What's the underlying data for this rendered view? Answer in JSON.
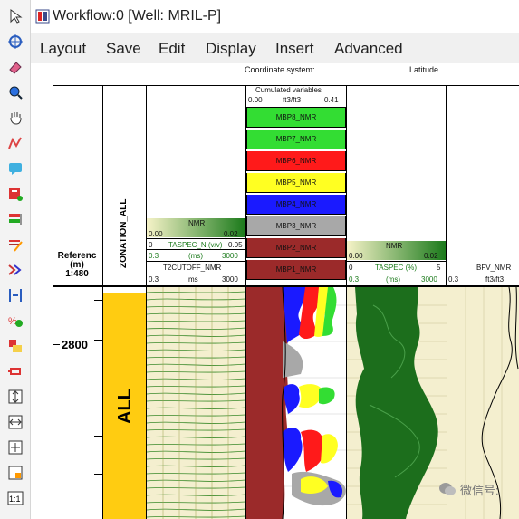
{
  "window": {
    "title": "Workflow:0 [Well: MRIL-P]"
  },
  "menu": {
    "items": [
      "Layout",
      "Save",
      "Edit",
      "Display",
      "Insert",
      "Advanced"
    ]
  },
  "toolbar": {
    "icons": [
      "pointer-icon",
      "crosshair-icon",
      "eraser-icon",
      "zoom-in-icon",
      "pan-hand-icon",
      "edit-curve-icon",
      "comment-icon",
      "add-track-icon",
      "track-order-icon",
      "edit-list-icon",
      "merge-icon",
      "spacing-icon",
      "add-green-icon",
      "scale-icon",
      "depth-marker-icon",
      "fit-vertical-icon",
      "fit-horizontal-icon",
      "fit-all-icon",
      "lock-scale-icon",
      "one-to-one-icon"
    ]
  },
  "header": {
    "coordinate_label": "Coordinate system:",
    "latitude_label": "Latitude",
    "reference": {
      "line1": "Referenc",
      "line2": "(m)",
      "line3": "1:480"
    },
    "zonation_label": "ZONATION_ALL",
    "track2": {
      "curve_title": "NMR",
      "fill_min": "0.00",
      "fill_max": "0.02",
      "taspec_label": "TASPEC_N (v/v)",
      "taspec_min": "0",
      "taspec_max": "0.05",
      "range_min": "0.3",
      "range_unit": "(ms)",
      "range_max": "3000",
      "t2_label": "T2CUTOFF_NMR",
      "t2_min": "0.3",
      "t2_unit": "ms",
      "t2_max": "3000"
    },
    "track3": {
      "title": "Cumulated variables",
      "min": "0.00",
      "unit": "ft3/ft3",
      "max": "0.41",
      "bins": [
        {
          "label": "MBP8_NMR",
          "color": "#33dd33"
        },
        {
          "label": "MBP7_NMR",
          "color": "#33dd33"
        },
        {
          "label": "MBP6_NMR",
          "color": "#ff1a1a"
        },
        {
          "label": "MBP5_NMR",
          "color": "#ffff22"
        },
        {
          "label": "MBP4_NMR",
          "color": "#1a1aff"
        },
        {
          "label": "MBP3_NMR",
          "color": "#a8a8a8"
        },
        {
          "label": "MBP2_NMR",
          "color": "#9b2a2a"
        },
        {
          "label": "MBP1_NMR",
          "color": "#9b2a2a"
        }
      ]
    },
    "track4": {
      "curve_title": "NMR",
      "fill_min": "0.00",
      "fill_max": "0.02",
      "taspec_label": "TASPEC (%)",
      "taspec_min": "0",
      "taspec_max": "5",
      "range_min": "0.3",
      "range_unit": "(ms)",
      "range_max": "3000"
    },
    "track5": {
      "label": "BFV_NMR",
      "min": "0.3",
      "unit": "ft3/ft3"
    }
  },
  "body": {
    "depth_label": "2800",
    "zone_label": "ALL"
  },
  "watermark": "微信号:",
  "colors": {
    "zone_fill": "#ffcc11",
    "track_bg": "#f8e7a8",
    "spectrum_green": "#1c6e1c"
  }
}
